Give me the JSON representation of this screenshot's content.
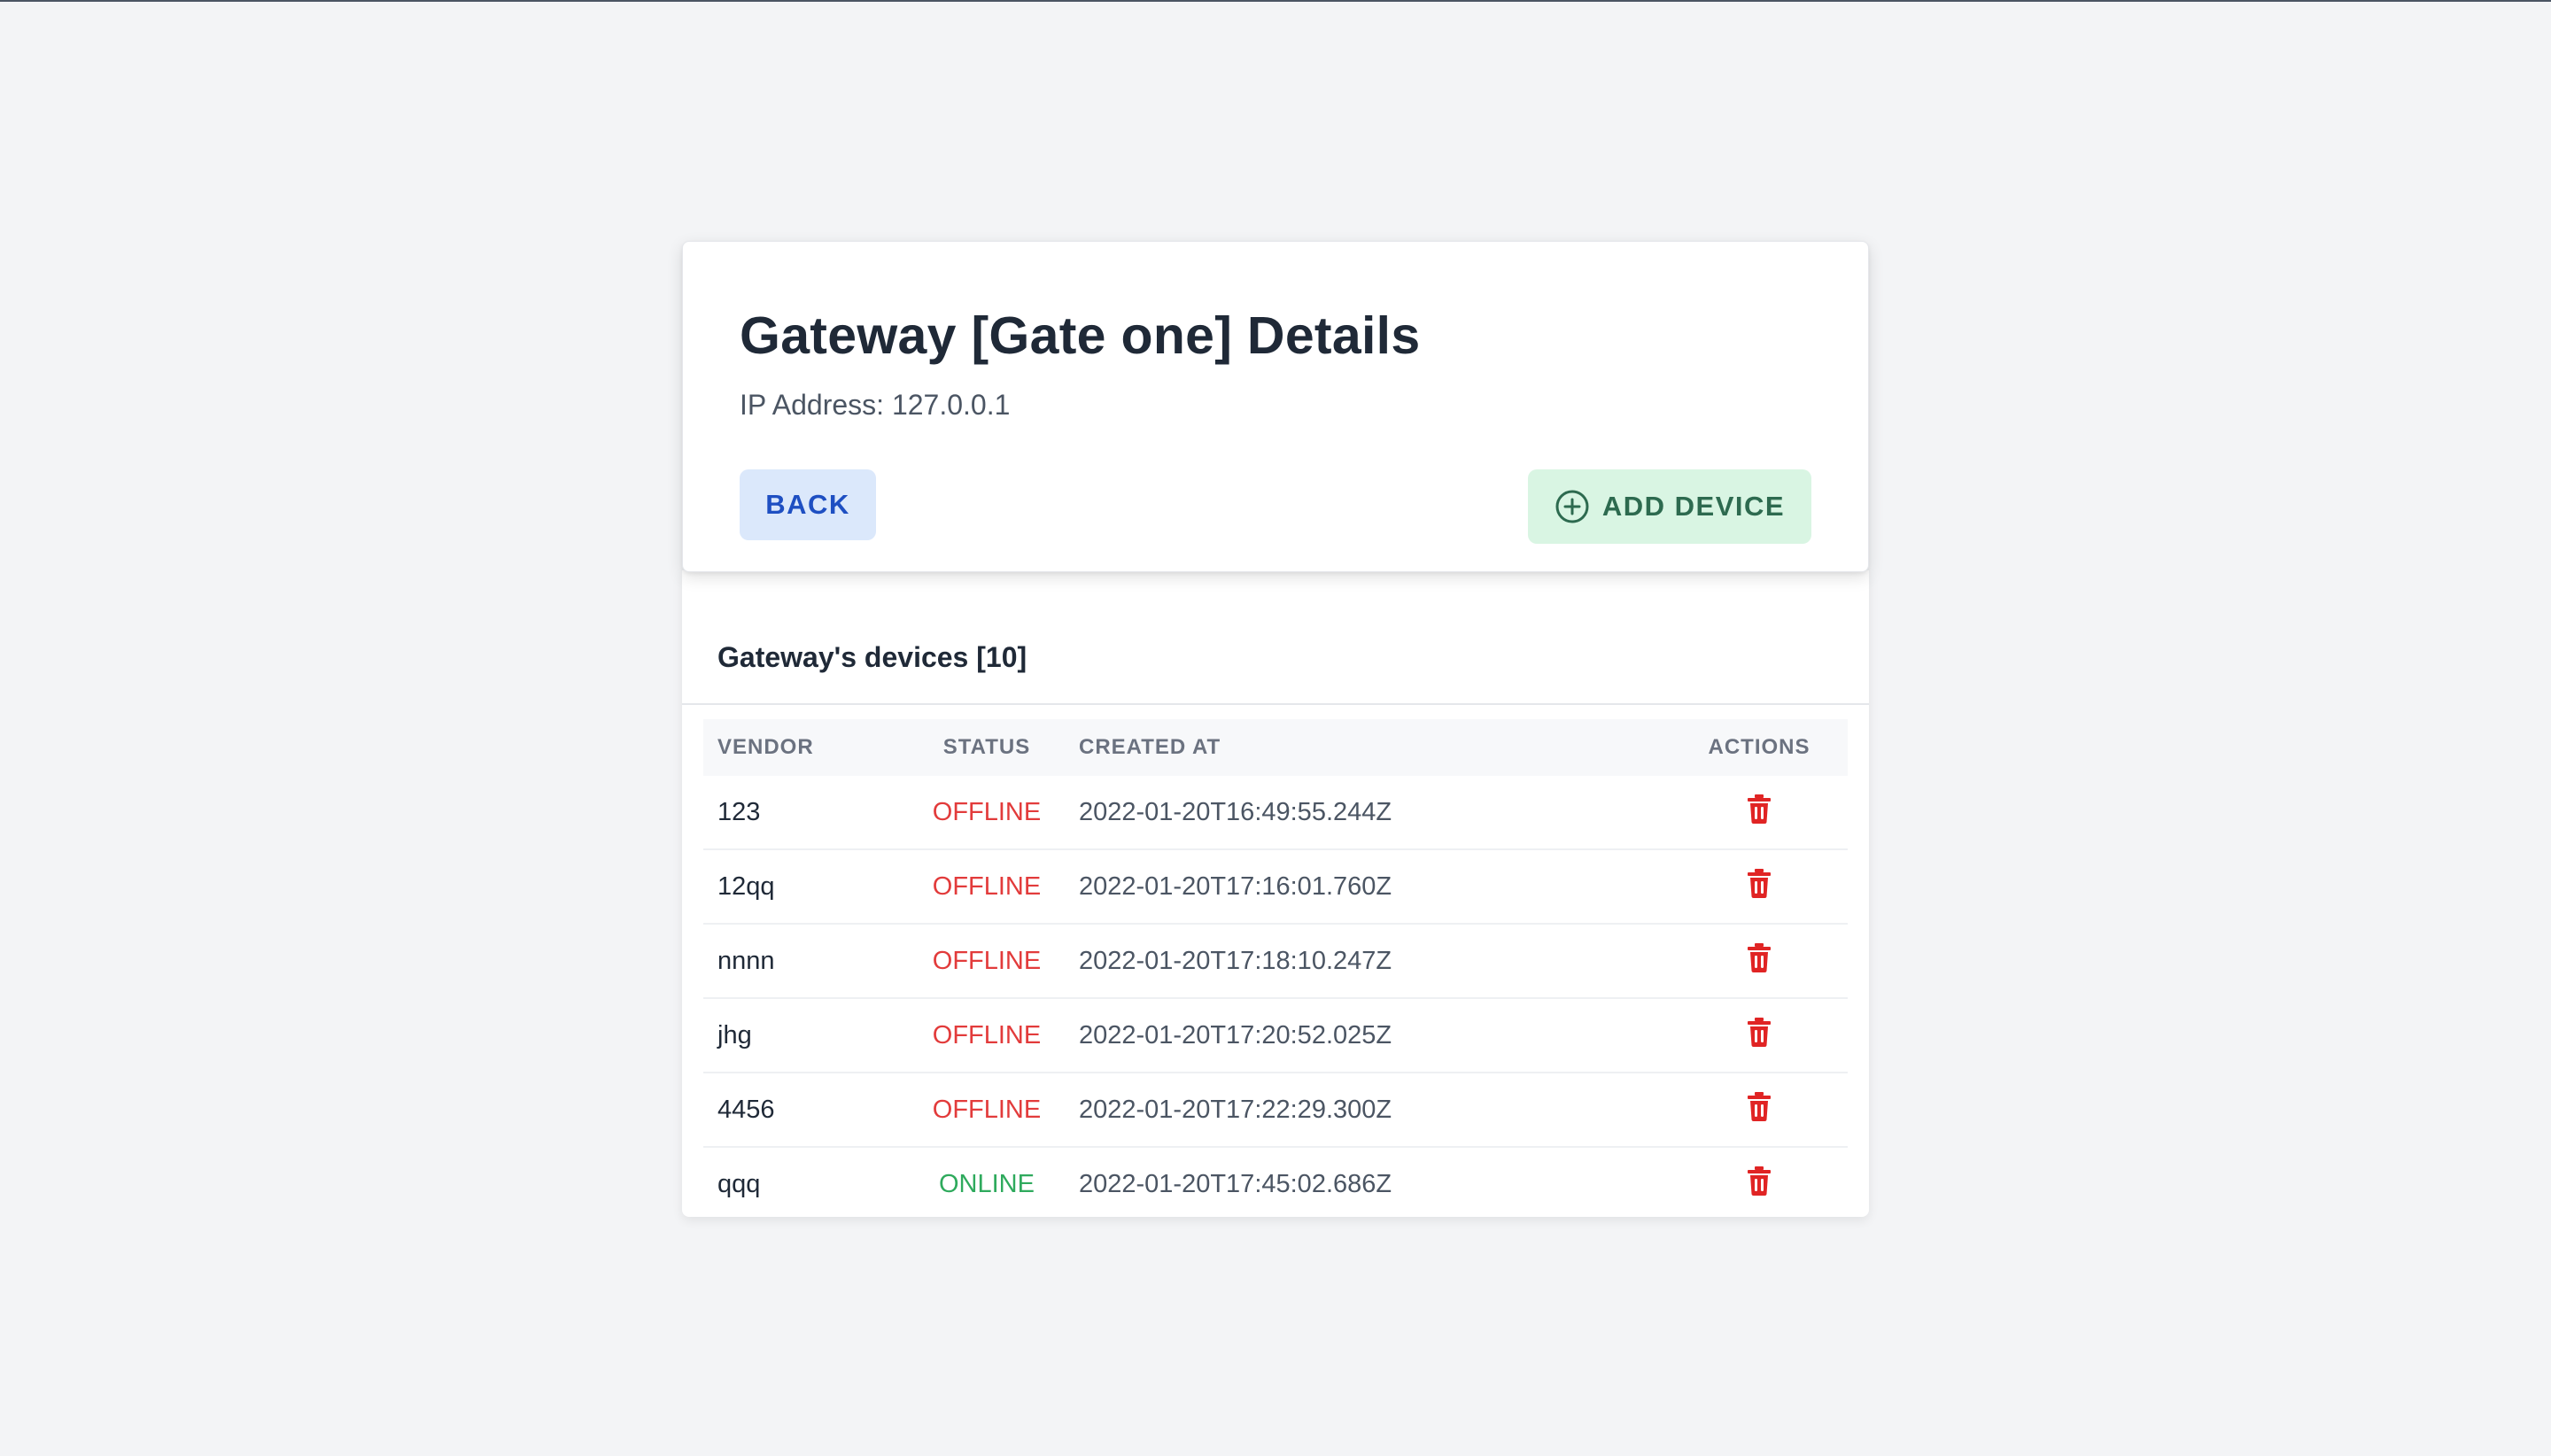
{
  "header": {
    "title": "Gateway [Gate one] Details",
    "ip_line": "IP Address: 127.0.0.1",
    "back_label": "BACK",
    "add_device_label": "ADD DEVICE",
    "add_device_icon": "plus-circle-icon"
  },
  "devices": {
    "heading": "Gateway's devices [10]",
    "columns": [
      "VENDOR",
      "STATUS",
      "CREATED AT",
      "ACTIONS"
    ],
    "rows": [
      {
        "vendor": "123",
        "status": "OFFLINE",
        "created_at": "2022-01-20T16:49:55.244Z"
      },
      {
        "vendor": "12qq",
        "status": "OFFLINE",
        "created_at": "2022-01-20T17:16:01.760Z"
      },
      {
        "vendor": "nnnn",
        "status": "OFFLINE",
        "created_at": "2022-01-20T17:18:10.247Z"
      },
      {
        "vendor": "jhg",
        "status": "OFFLINE",
        "created_at": "2022-01-20T17:20:52.025Z"
      },
      {
        "vendor": "4456",
        "status": "OFFLINE",
        "created_at": "2022-01-20T17:22:29.300Z"
      },
      {
        "vendor": "qqq",
        "status": "ONLINE",
        "created_at": "2022-01-20T17:45:02.686Z"
      }
    ],
    "action_icon": "trash-icon"
  },
  "colors": {
    "offline": "#e23b3b",
    "online": "#2faa5d",
    "delete": "#e02424",
    "back_bg": "#dbe8fb",
    "back_text": "#1e4fc2",
    "add_bg": "#d9f5e3",
    "add_text": "#2d6a4f",
    "page_bg": "#f3f4f6"
  }
}
